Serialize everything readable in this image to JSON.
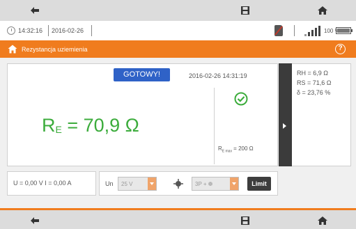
{
  "status": {
    "time": "14:32:16",
    "date": "2016-02-26",
    "battery_pct": "100 %"
  },
  "title": {
    "text": "Rezystancja uziemienia",
    "help_glyph": "?"
  },
  "measurement": {
    "status_badge": "GOTOWY!",
    "timestamp": "2016-02-26 14:31:19",
    "result_symbol": "R",
    "result_sub": "E",
    "result_value": " = 70,9 Ω",
    "rmax_symbol": "R",
    "rmax_sub": "E max",
    "rmax_value": " = 200 Ω"
  },
  "side_values": [
    {
      "text": "RH = 6,9 Ω"
    },
    {
      "text": "RS = 71,6 Ω"
    },
    {
      "text": "δ  = 23,76 %"
    }
  ],
  "controls": {
    "u_i_readout": "U = 0,00 V  I = 0,00 A",
    "un_label": "Un",
    "un_value": "25 V",
    "method_value": "3P + ❁",
    "limit_label": "Limit"
  },
  "colors": {
    "accent": "#f07c1e",
    "result_green": "#3cac3c",
    "ready_blue": "#2f62c7"
  },
  "icons": {
    "nav_back": "arrow-left-icon",
    "nav_save": "save-icon",
    "nav_home": "home-icon"
  }
}
